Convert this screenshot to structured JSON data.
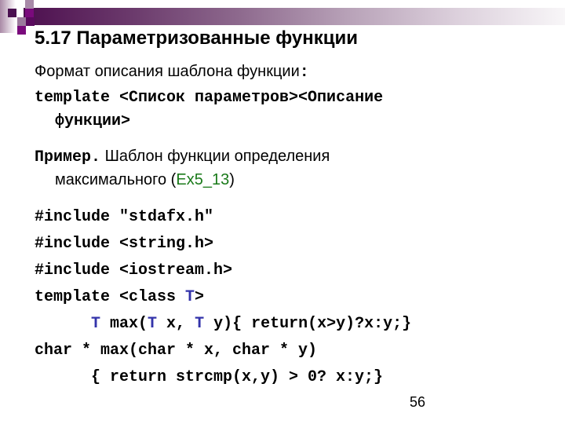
{
  "slide": {
    "title": "5.17 Параметризованные функции",
    "format_label": "Формат описания шаблона функции",
    "format_colon": ":",
    "template_line1": "template <Список параметров><Описание",
    "template_line2": "функции>",
    "example_label": "Пример.",
    "example_text1": " Шаблон функции определения",
    "example_text2_pre": "максимального (",
    "example_link": "Ex5_13",
    "example_text2_post": ")",
    "code": {
      "line1": "#include \"stdafx.h\"",
      "line2": "#include <string.h>",
      "line3": "#include <iostream.h>",
      "line4_pre": "template <class ",
      "line4_T": "T",
      "line4_post": ">",
      "line5_T1": "T",
      "line5_a": " max(",
      "line5_T2": "T",
      "line5_b": " x, ",
      "line5_T3": "T",
      "line5_c": " y){ return(x>y)?x:y;}",
      "line6": "char * max(char * x, char * y)",
      "line7": "{ return strcmp(x,y) > 0? x:y;}"
    },
    "page_number": "56"
  },
  "colors": {
    "type_param": "#3333aa",
    "link_green": "#1a7a1a",
    "accent_purple": "#4d0f4f"
  }
}
